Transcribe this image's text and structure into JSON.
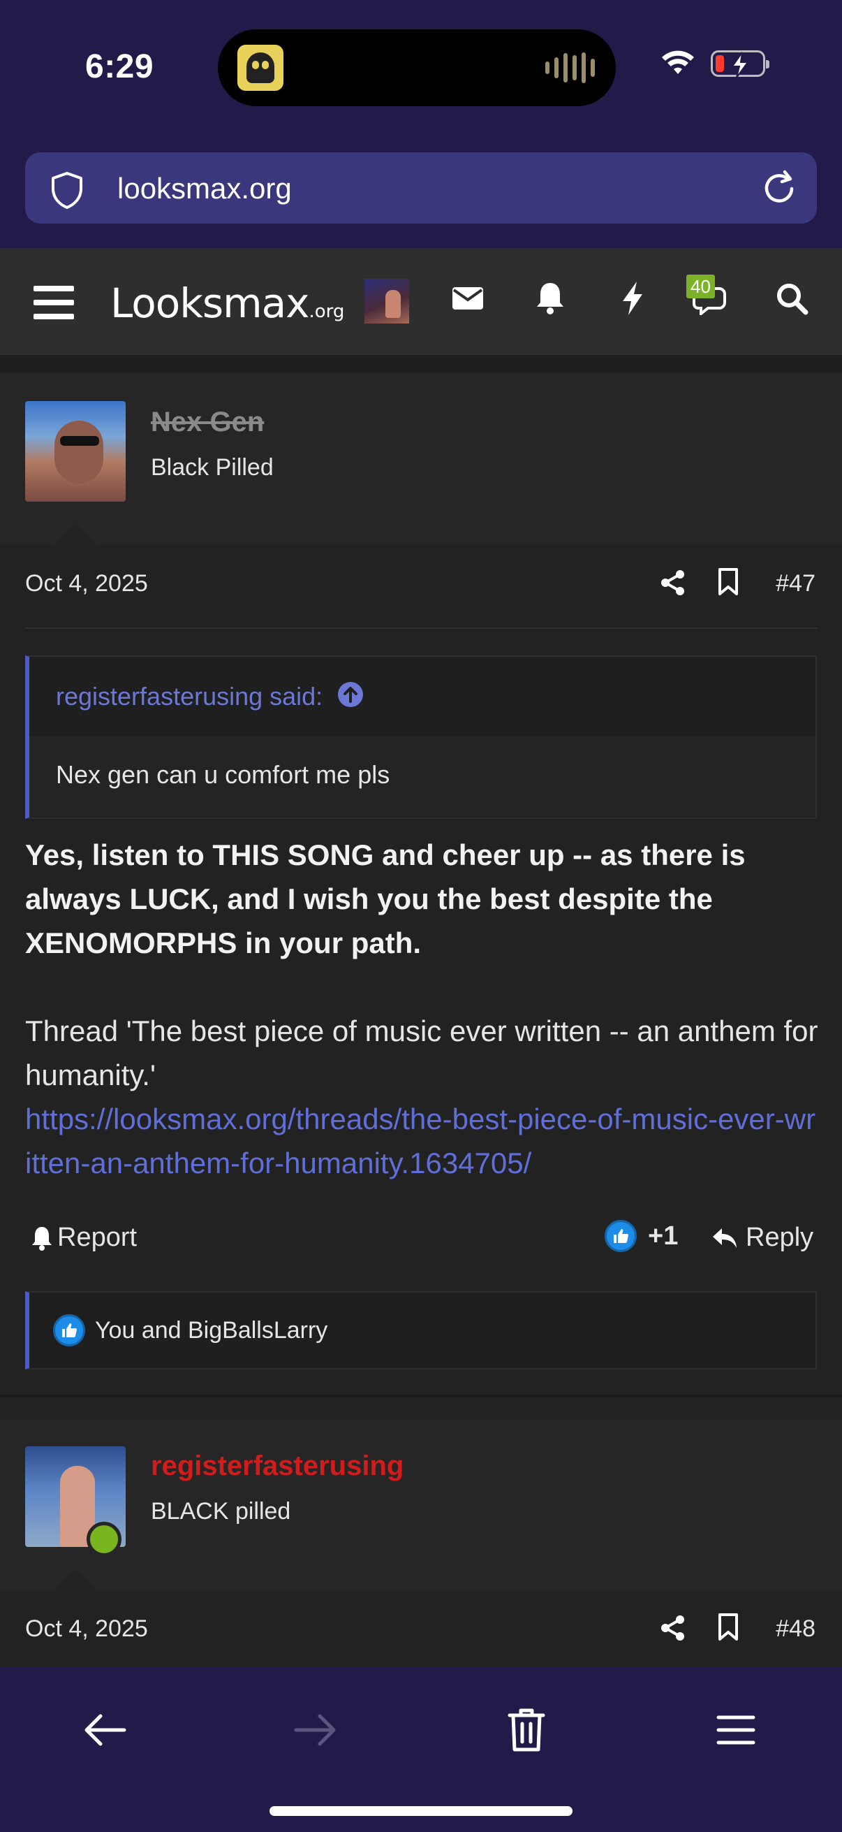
{
  "status": {
    "time": "6:29",
    "battery_color": "#ff3b30"
  },
  "browser": {
    "url": "looksmax.org",
    "icons": [
      "shield-icon",
      "reload-icon"
    ]
  },
  "site_nav": {
    "logo": "Looksmax",
    "logo_suffix": ".org",
    "messages_badge": "40",
    "icons": [
      "menu-icon",
      "envelope-icon",
      "bell-icon",
      "bolt-icon",
      "chat-icon",
      "search-icon"
    ]
  },
  "posts": [
    {
      "username": "Nex Gen",
      "user_title": "Black Pilled",
      "date": "Oct 4, 2025",
      "number": "#47",
      "quote": {
        "author": "registerfasterusing said:",
        "text": "Nex gen can u comfort me pls"
      },
      "bold_text": "Yes, listen to THIS SONG and cheer up -- as there is always LUCK, and I wish you the best despite the XENOMORPHS in your path.",
      "thread_text": "Thread 'The best piece of music ever written -- an anthem for humanity.'",
      "link": "https://looksmax.org/threads/the-best-piece-of-music-ever-written-an-anthem-for-humanity.1634705/",
      "report_label": "Report",
      "reaction_count": "+1",
      "reply_label": "Reply",
      "reactions_text": "You and BigBallsLarry"
    },
    {
      "username": "registerfasterusing",
      "user_title": "BLACK pilled",
      "date": "Oct 4, 2025",
      "number": "#48"
    }
  ],
  "colors": {
    "accent_link": "#5f6ed8",
    "username_red": "#d11c1c",
    "online_green": "#79b51f",
    "browser_chrome": "#221a48"
  }
}
